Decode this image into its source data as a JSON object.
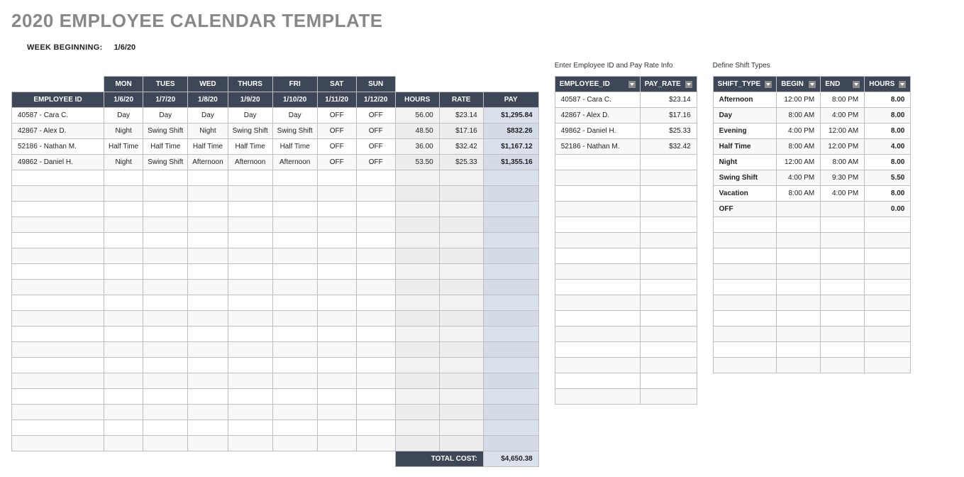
{
  "title": "2020 EMPLOYEE CALENDAR TEMPLATE",
  "week_label": "WEEK BEGINNING:",
  "week_date": "1/6/20",
  "main_table": {
    "day_headers": [
      "MON",
      "TUES",
      "WED",
      "THURS",
      "FRI",
      "SAT",
      "SUN"
    ],
    "headers": [
      "EMPLOYEE ID",
      "1/6/20",
      "1/7/20",
      "1/8/20",
      "1/9/20",
      "1/10/20",
      "1/11/20",
      "1/12/20",
      "HOURS",
      "RATE",
      "PAY"
    ],
    "rows": [
      {
        "emp": "40587 - Cara C.",
        "d": [
          "Day",
          "Day",
          "Day",
          "Day",
          "Day",
          "OFF",
          "OFF"
        ],
        "hours": "56.00",
        "rate": "$23.14",
        "pay": "$1,295.84"
      },
      {
        "emp": "42867 - Alex D.",
        "d": [
          "Night",
          "Swing Shift",
          "Night",
          "Swing Shift",
          "Swing Shift",
          "OFF",
          "OFF"
        ],
        "hours": "48.50",
        "rate": "$17.16",
        "pay": "$832.26"
      },
      {
        "emp": "52186 - Nathan M.",
        "d": [
          "Half Time",
          "Half Time",
          "Half Time",
          "Half Time",
          "Half Time",
          "OFF",
          "OFF"
        ],
        "hours": "36.00",
        "rate": "$32.42",
        "pay": "$1,167.12"
      },
      {
        "emp": "49862 - Daniel H.",
        "d": [
          "Night",
          "Swing Shift",
          "Afternoon",
          "Afternoon",
          "Afternoon",
          "OFF",
          "OFF"
        ],
        "hours": "53.50",
        "rate": "$25.33",
        "pay": "$1,355.16"
      }
    ],
    "blank_rows": 18,
    "total_label": "TOTAL COST:",
    "total_value": "$4,650.38"
  },
  "emp_section": {
    "label": "Enter Employee ID and Pay Rate Info",
    "headers": [
      "EMPLOYEE_ID",
      "PAY_RATE"
    ],
    "rows": [
      {
        "id": "40587 - Cara C.",
        "rate": "$23.14"
      },
      {
        "id": "42867 - Alex D.",
        "rate": "$17.16"
      },
      {
        "id": "49862 - Daniel H.",
        "rate": "$25.33"
      },
      {
        "id": "52186 - Nathan M.",
        "rate": "$32.42"
      }
    ],
    "blank_rows": 16
  },
  "shift_section": {
    "label": "Define Shift Types",
    "headers": [
      "SHIFT_TYPE",
      "BEGIN",
      "END",
      "HOURS"
    ],
    "rows": [
      {
        "t": "Afternoon",
        "b": "12:00 PM",
        "e": "8:00 PM",
        "h": "8.00"
      },
      {
        "t": "Day",
        "b": "8:00 AM",
        "e": "4:00 PM",
        "h": "8.00"
      },
      {
        "t": "Evening",
        "b": "4:00 PM",
        "e": "12:00 AM",
        "h": "8.00"
      },
      {
        "t": "Half Time",
        "b": "8:00 AM",
        "e": "12:00 PM",
        "h": "4.00"
      },
      {
        "t": "Night",
        "b": "12:00 AM",
        "e": "8:00 AM",
        "h": "8.00"
      },
      {
        "t": "Swing Shift",
        "b": "4:00 PM",
        "e": "9:30 PM",
        "h": "5.50"
      },
      {
        "t": "Vacation",
        "b": "8:00 AM",
        "e": "4:00 PM",
        "h": "8.00"
      },
      {
        "t": "OFF",
        "b": "",
        "e": "",
        "h": "0.00"
      }
    ],
    "blank_rows": 10
  }
}
